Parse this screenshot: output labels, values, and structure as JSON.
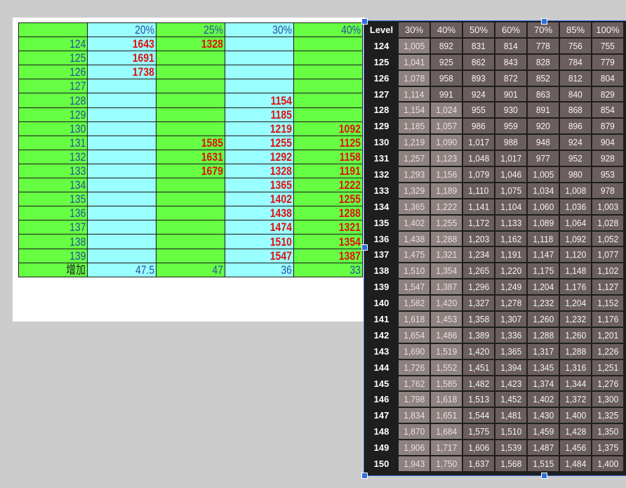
{
  "sheet": {
    "header": [
      "",
      "20%",
      "25%",
      "30%",
      "40%"
    ],
    "rows": [
      {
        "level": "124",
        "cells": [
          "1643",
          "1328",
          "",
          ""
        ]
      },
      {
        "level": "125",
        "cells": [
          "1691",
          "",
          "",
          ""
        ]
      },
      {
        "level": "126",
        "cells": [
          "1738",
          "",
          "",
          ""
        ]
      },
      {
        "level": "127",
        "cells": [
          "",
          "",
          "",
          ""
        ]
      },
      {
        "level": "128",
        "cells": [
          "",
          "",
          "1154",
          ""
        ]
      },
      {
        "level": "129",
        "cells": [
          "",
          "",
          "1185",
          ""
        ]
      },
      {
        "level": "130",
        "cells": [
          "",
          "",
          "1219",
          "1092"
        ]
      },
      {
        "level": "131",
        "cells": [
          "",
          "1585",
          "1255",
          "1125"
        ]
      },
      {
        "level": "132",
        "cells": [
          "",
          "1631",
          "1292",
          "1158"
        ]
      },
      {
        "level": "133",
        "cells": [
          "",
          "1679",
          "1328",
          "1191"
        ]
      },
      {
        "level": "134",
        "cells": [
          "",
          "",
          "1365",
          "1222"
        ]
      },
      {
        "level": "135",
        "cells": [
          "",
          "",
          "1402",
          "1255"
        ]
      },
      {
        "level": "136",
        "cells": [
          "",
          "",
          "1438",
          "1288"
        ]
      },
      {
        "level": "137",
        "cells": [
          "",
          "",
          "1474",
          "1321"
        ]
      },
      {
        "level": "138",
        "cells": [
          "",
          "",
          "1510",
          "1354"
        ]
      },
      {
        "level": "139",
        "cells": [
          "",
          "",
          "1547",
          "1387"
        ]
      }
    ],
    "footer": [
      "增加",
      "47.5",
      "47",
      "36",
      "33"
    ],
    "colors": {
      "green": "#66ff44",
      "cyan": "#99ffff",
      "red_value": "#e01010",
      "border": "#1a1a1a"
    }
  },
  "level_table": {
    "header": [
      "Level",
      "30%",
      "40%",
      "50%",
      "60%",
      "70%",
      "85%",
      "100%"
    ],
    "rows": [
      [
        "124",
        "1,005",
        "892",
        "831",
        "814",
        "778",
        "756",
        "755"
      ],
      [
        "125",
        "1,041",
        "925",
        "862",
        "843",
        "828",
        "784",
        "779"
      ],
      [
        "126",
        "1,078",
        "958",
        "893",
        "872",
        "852",
        "812",
        "804"
      ],
      [
        "127",
        "1,114",
        "991",
        "924",
        "901",
        "863",
        "840",
        "829"
      ],
      [
        "128",
        "1,154",
        "1,024",
        "955",
        "930",
        "891",
        "868",
        "854"
      ],
      [
        "129",
        "1,185",
        "1,057",
        "986",
        "959",
        "920",
        "896",
        "879"
      ],
      [
        "130",
        "1,219",
        "1,090",
        "1,017",
        "988",
        "948",
        "924",
        "904"
      ],
      [
        "131",
        "1,257",
        "1,123",
        "1,048",
        "1,017",
        "977",
        "952",
        "928"
      ],
      [
        "132",
        "1,293",
        "1,156",
        "1,079",
        "1,046",
        "1,005",
        "980",
        "953"
      ],
      [
        "133",
        "1,329",
        "1,189",
        "1,110",
        "1,075",
        "1,034",
        "1,008",
        "978"
      ],
      [
        "134",
        "1,365",
        "1,222",
        "1,141",
        "1,104",
        "1,060",
        "1,036",
        "1,003"
      ],
      [
        "135",
        "1,402",
        "1,255",
        "1,172",
        "1,133",
        "1,089",
        "1,064",
        "1,028"
      ],
      [
        "136",
        "1,438",
        "1,288",
        "1,203",
        "1,162",
        "1,118",
        "1,092",
        "1,052"
      ],
      [
        "137",
        "1,475",
        "1,321",
        "1,234",
        "1,191",
        "1,147",
        "1,120",
        "1,077"
      ],
      [
        "138",
        "1,510",
        "1,354",
        "1,265",
        "1,220",
        "1,175",
        "1,148",
        "1,102"
      ],
      [
        "139",
        "1,547",
        "1,387",
        "1,296",
        "1,249",
        "1,204",
        "1,176",
        "1,127"
      ],
      [
        "140",
        "1,582",
        "1,420",
        "1,327",
        "1,278",
        "1,232",
        "1,204",
        "1,152"
      ],
      [
        "141",
        "1,618",
        "1,453",
        "1,358",
        "1,307",
        "1,260",
        "1,232",
        "1,176"
      ],
      [
        "142",
        "1,654",
        "1,486",
        "1,389",
        "1,336",
        "1,288",
        "1,260",
        "1,201"
      ],
      [
        "143",
        "1,690",
        "1,519",
        "1,420",
        "1,365",
        "1,317",
        "1,288",
        "1,226"
      ],
      [
        "144",
        "1,726",
        "1,552",
        "1,451",
        "1,394",
        "1,345",
        "1,316",
        "1,251"
      ],
      [
        "145",
        "1,762",
        "1,585",
        "1,482",
        "1,423",
        "1,374",
        "1,344",
        "1,276"
      ],
      [
        "146",
        "1,798",
        "1,618",
        "1,513",
        "1,452",
        "1,402",
        "1,372",
        "1,300"
      ],
      [
        "147",
        "1,834",
        "1,651",
        "1,544",
        "1,481",
        "1,430",
        "1,400",
        "1,325"
      ],
      [
        "148",
        "1,870",
        "1,684",
        "1,575",
        "1,510",
        "1,459",
        "1,428",
        "1,350"
      ],
      [
        "149",
        "1,906",
        "1,717",
        "1,606",
        "1,539",
        "1,487",
        "1,456",
        "1,375"
      ],
      [
        "150",
        "1,943",
        "1,750",
        "1,637",
        "1,568",
        "1,515",
        "1,484",
        "1,400"
      ]
    ],
    "colors": {
      "background": "#1e1e1e",
      "cell": "#6b5f5e",
      "cell_highlight": "#8e8281",
      "selection": "#2f6fdc"
    }
  }
}
